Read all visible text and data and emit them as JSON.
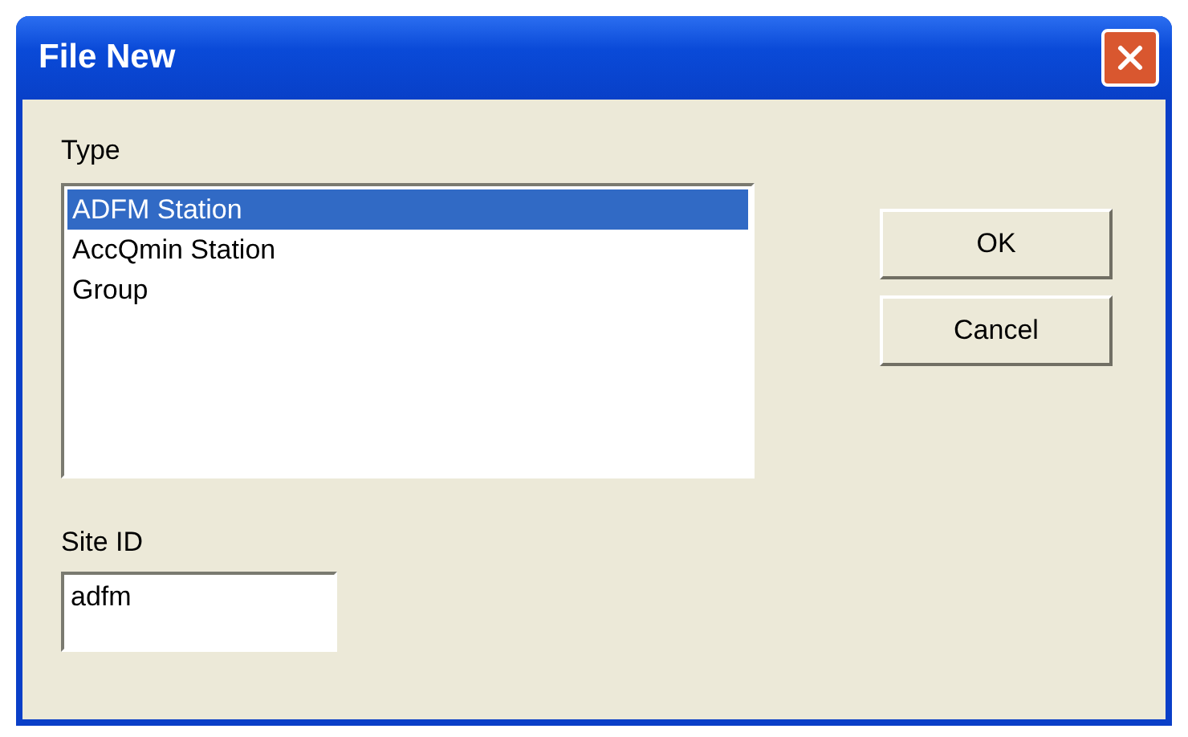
{
  "window": {
    "title": "File New"
  },
  "type_label": "Type",
  "type_list": [
    {
      "label": "ADFM Station",
      "selected": true
    },
    {
      "label": "AccQmin Station",
      "selected": false
    },
    {
      "label": "Group",
      "selected": false
    }
  ],
  "buttons": [
    {
      "label": "OK"
    },
    {
      "label": "Cancel"
    }
  ],
  "site_id": {
    "label": "Site ID",
    "value": "adfm"
  }
}
